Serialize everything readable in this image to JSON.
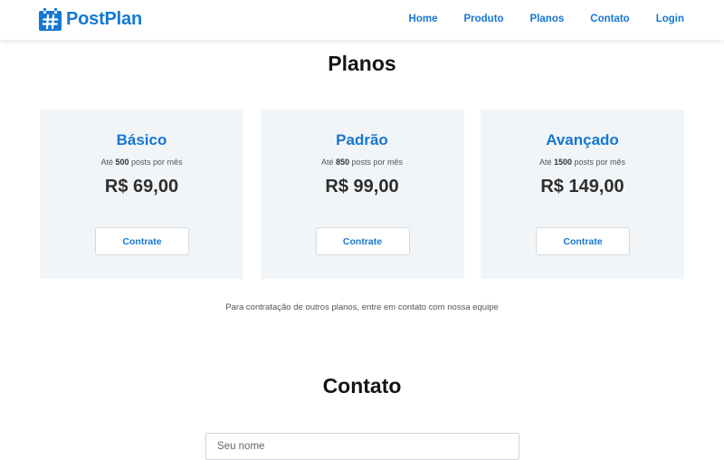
{
  "brand": {
    "name": "PostPlan",
    "logo_icon": "hash-calendar-icon",
    "accent_color": "#1677d2"
  },
  "nav": {
    "items": [
      {
        "label": "Home"
      },
      {
        "label": "Produto"
      },
      {
        "label": "Planos"
      },
      {
        "label": "Contato"
      },
      {
        "label": "Login"
      }
    ]
  },
  "plans_section": {
    "title": "Planos",
    "plans": [
      {
        "name": "Básico",
        "desc_prefix": "Até",
        "posts": "500",
        "desc_suffix": "posts por mês",
        "price": "R$ 69,00",
        "button": "Contrate"
      },
      {
        "name": "Padrão",
        "desc_prefix": "Até",
        "posts": "850",
        "desc_suffix": "posts por mês",
        "price": "R$ 99,00",
        "button": "Contrate"
      },
      {
        "name": "Avançado",
        "desc_prefix": "Até",
        "posts": "1500",
        "desc_suffix": "posts por mês",
        "price": "R$ 149,00",
        "button": "Contrate"
      }
    ],
    "note": "Para contratação de outros planos, entre em contato com nossa equipe"
  },
  "contact_section": {
    "title": "Contato",
    "name_placeholder": "Seu nome",
    "name_value": ""
  }
}
